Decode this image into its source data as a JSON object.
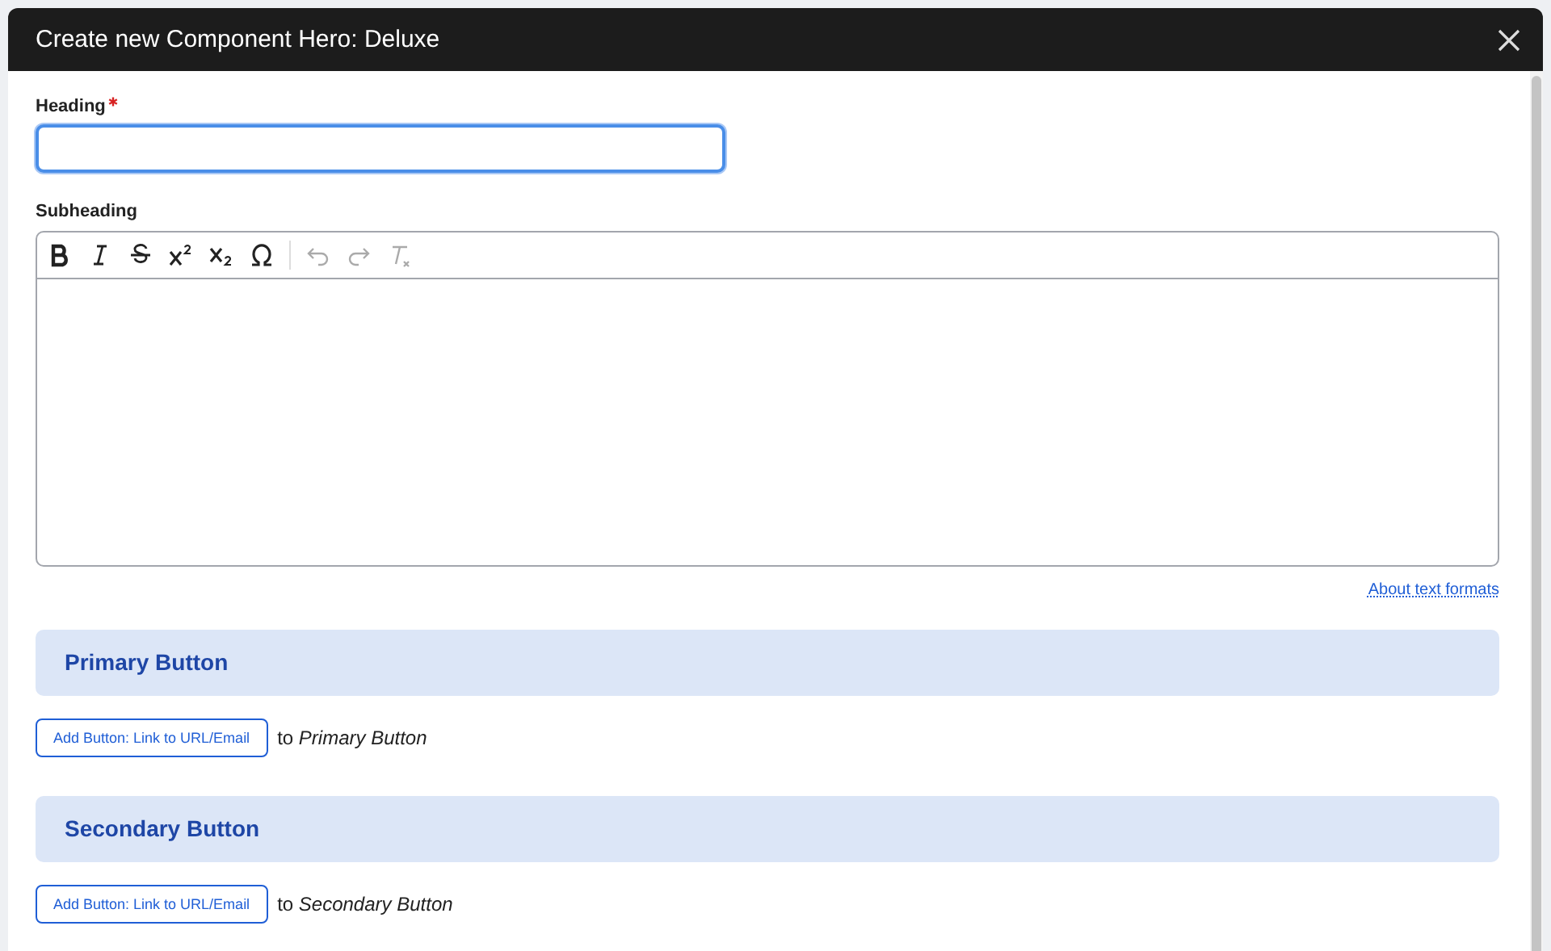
{
  "dialog": {
    "title": "Create new Component Hero: Deluxe"
  },
  "heading_field": {
    "label": "Heading",
    "required": true,
    "focused": true
  },
  "subheading_field": {
    "label": "Subheading",
    "toolbar": [
      {
        "kind": "bold",
        "disabled": false
      },
      {
        "kind": "italic",
        "disabled": false
      },
      {
        "kind": "strike",
        "disabled": false
      },
      {
        "kind": "superscript",
        "disabled": false
      },
      {
        "kind": "subscript",
        "disabled": false
      },
      {
        "kind": "omega",
        "disabled": false
      },
      {
        "kind": "undo",
        "disabled": true
      },
      {
        "kind": "redo",
        "disabled": true
      },
      {
        "kind": "clear-format",
        "disabled": true
      }
    ],
    "help_link": "About text formats"
  },
  "sections": [
    {
      "title": "Primary Button",
      "add_button": "Add Button: Link to URL/Email",
      "target": "to *Primary Button*"
    },
    {
      "title": "Secondary Button",
      "add_button": "Add Button: Link to URL/Email",
      "target": "to *Secondary Button*"
    }
  ]
}
